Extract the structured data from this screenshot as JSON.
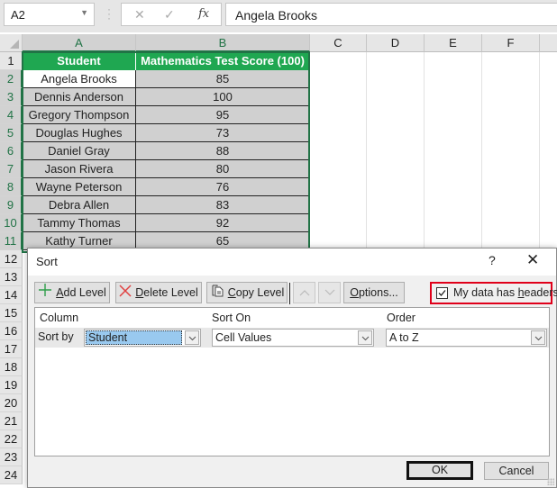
{
  "formula_bar": {
    "name_box": "A2",
    "cancel_icon": "✕",
    "enter_icon": "✓",
    "fx_label": "fx",
    "formula_value": "Angela Brooks"
  },
  "columns": [
    "A",
    "B",
    "C",
    "D",
    "E",
    "F"
  ],
  "rows": [
    "1",
    "2",
    "3",
    "4",
    "5",
    "6",
    "7",
    "8",
    "9",
    "10",
    "11",
    "12",
    "13",
    "14",
    "15",
    "16",
    "17",
    "18",
    "19",
    "20",
    "21",
    "22",
    "23",
    "24"
  ],
  "table": {
    "headers": [
      "Student",
      "Mathematics Test Score (100)"
    ],
    "rows": [
      [
        "Angela Brooks",
        "85"
      ],
      [
        "Dennis Anderson",
        "100"
      ],
      [
        "Gregory Thompson",
        "95"
      ],
      [
        "Douglas Hughes",
        "73"
      ],
      [
        "Daniel Gray",
        "88"
      ],
      [
        "Jason Rivera",
        "80"
      ],
      [
        "Wayne Peterson",
        "76"
      ],
      [
        "Debra Allen",
        "83"
      ],
      [
        "Tammy Thomas",
        "92"
      ],
      [
        "Kathy Turner",
        "65"
      ]
    ]
  },
  "colors": {
    "header_fill": "#1fa751",
    "data_fill": "#d0d0d0",
    "excel_green": "#217346",
    "highlight_red": "#e0001a"
  },
  "dialog": {
    "title": "Sort",
    "help_label": "?",
    "close_label": "✕",
    "toolbar": {
      "add_level_mnemonic": "A",
      "add_level_rest": "dd Level",
      "delete_level_mnemonic": "D",
      "delete_level_rest": "elete Level",
      "copy_level_mnemonic": "C",
      "copy_level_rest": "opy Level",
      "options_mnemonic": "O",
      "options_rest": "ptions..."
    },
    "headers_checkbox": {
      "label_pre": "My data has ",
      "label_mnemonic": "h",
      "label_post": "eaders",
      "checked": true
    },
    "columns": {
      "column": "Column",
      "sort_on": "Sort On",
      "order": "Order"
    },
    "level": {
      "label": "Sort by",
      "column_value": "Student",
      "sort_on_value": "Cell Values",
      "order_value": "A to Z"
    },
    "ok_label": "OK",
    "cancel_label": "Cancel"
  }
}
